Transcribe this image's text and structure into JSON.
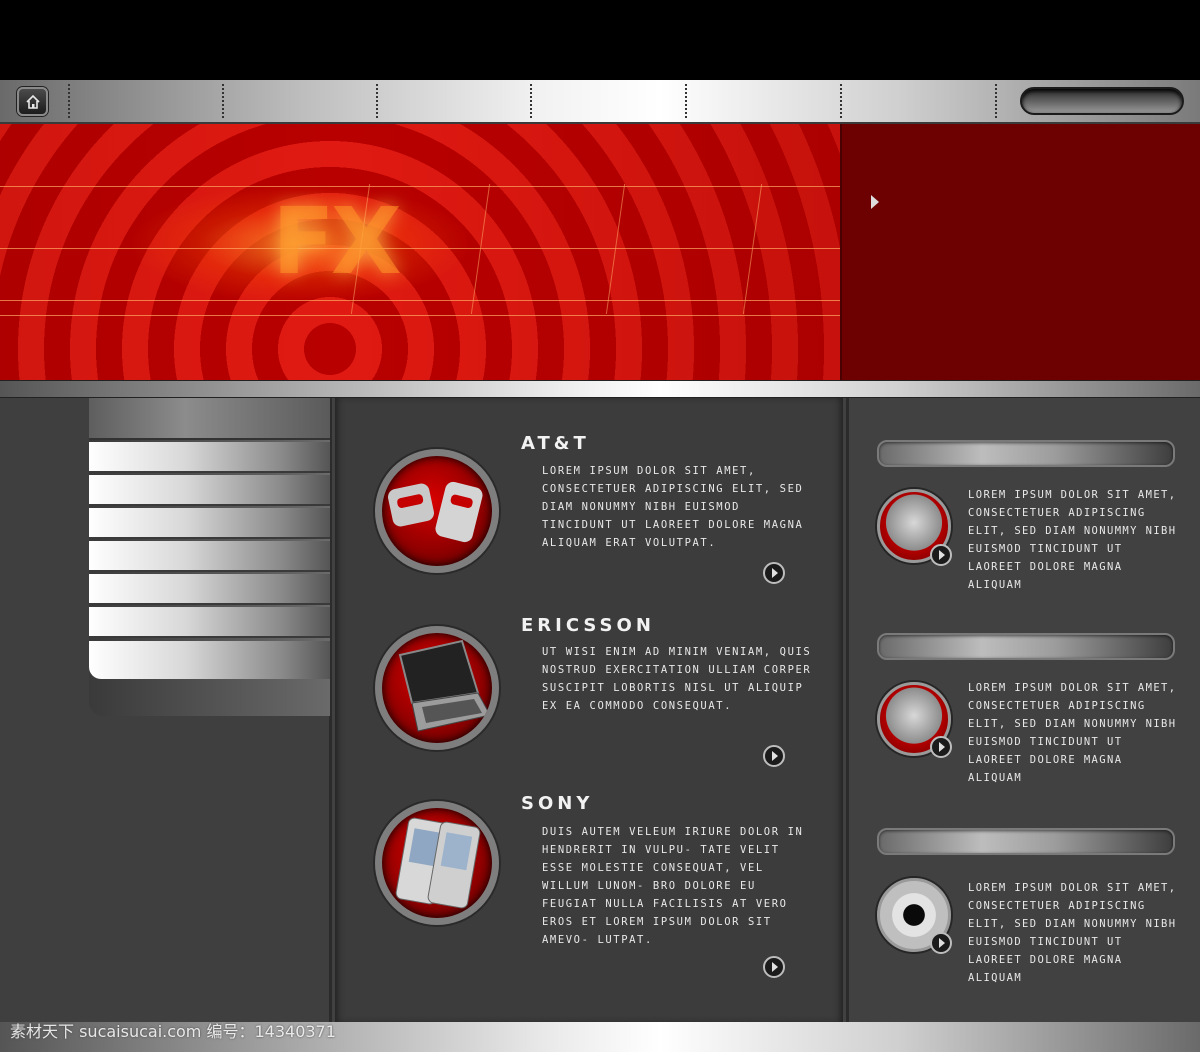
{
  "hero": {
    "logo_text": "FX"
  },
  "products": [
    {
      "title": "AT&T",
      "text": "LOREM IPSUM DOLOR SIT AMET, CONSECTETUER ADIPISCING ELIT, SED DIAM NONUMMY NIBH EUISMOD TINCIDUNT UT LAOREET DOLORE MAGNA ALIQUAM ERAT VOLUTPAT.",
      "icon": "phone-flip-icon"
    },
    {
      "title": "ERICSSON",
      "text": "UT WISI ENIM AD MINIM VENIAM, QUIS NOSTRUD EXERCITATION ULLIAM CORPER SUSCIPIT LOBORTIS NISL UT ALIQUIP EX EA COMMODO CONSEQUAT.",
      "icon": "laptop-icon"
    },
    {
      "title": "SONY",
      "text": "DUIS AUTEM VELEUM IRIURE DOLOR IN HENDRERIT IN VULPU- TATE VELIT ESSE MOLESTIE CONSEQUAT, VEL WILLUM LUNOM- BRO DOLORE EU FEUGIAT NULLA FACILISIS AT VERO EROS ET LOREM IPSUM DOLOR SIT AMEVO- LUTPAT.",
      "icon": "pda-icon"
    }
  ],
  "side_items": [
    {
      "text": "LOREM IPSUM DOLOR SIT AMET, CONSECTETUER ADIPISCING ELIT, SED DIAM NONUMMY NIBH EUISMOD TINCIDUNT UT LAOREET DOLORE MAGNA ALIQUAM",
      "icon": "speaker-icon"
    },
    {
      "text": "LOREM IPSUM DOLOR SIT AMET, CONSECTETUER ADIPISCING ELIT, SED DIAM NONUMMY NIBH EUISMOD TINCIDUNT UT LAOREET DOLORE MAGNA ALIQUAM",
      "icon": "speaker-icon"
    },
    {
      "text": "LOREM IPSUM DOLOR SIT AMET, CONSECTETUER ADIPISCING ELIT, SED DIAM NONUMMY NIBH EUISMOD TINCIDUNT UT LAOREET DOLORE MAGNA ALIQUAM",
      "icon": "cup-icon"
    }
  ],
  "watermark": "素材天下 sucaisucai.com   编号：14340371",
  "colors": {
    "accent_red": "#c00000",
    "dark_red": "#6d0000",
    "panel": "#3c3c3c"
  }
}
